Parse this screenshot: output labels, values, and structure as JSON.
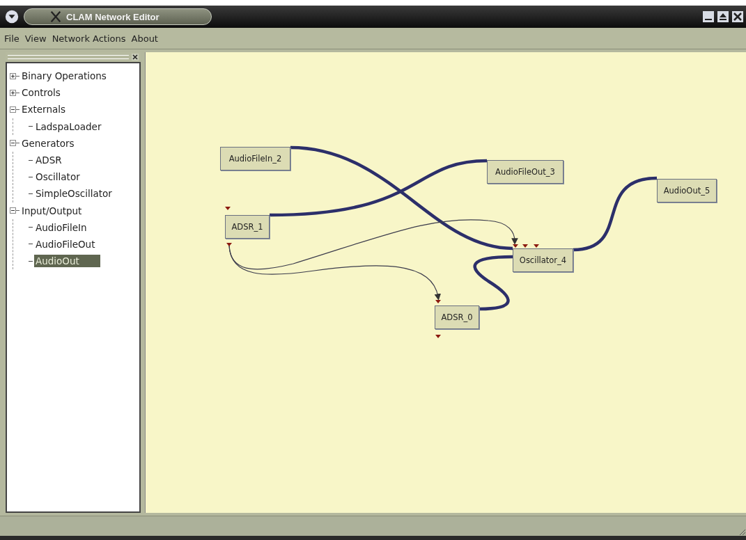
{
  "window": {
    "title": "CLAM Network Editor"
  },
  "menu": [
    {
      "label": "File"
    },
    {
      "label": "View"
    },
    {
      "label": "Network Actions"
    },
    {
      "label": "About"
    }
  ],
  "tree": [
    {
      "label": "Binary Operations",
      "expanded": false,
      "selected": false
    },
    {
      "label": "Controls",
      "expanded": false,
      "selected": false
    },
    {
      "label": "Externals",
      "expanded": true,
      "selected": false,
      "children": [
        {
          "label": "LadspaLoader",
          "selected": false
        }
      ]
    },
    {
      "label": "Generators",
      "expanded": true,
      "selected": false,
      "children": [
        {
          "label": "ADSR",
          "selected": false
        },
        {
          "label": "Oscillator",
          "selected": false
        },
        {
          "label": "SimpleOscillator",
          "selected": false
        }
      ]
    },
    {
      "label": "Input/Output",
      "expanded": true,
      "selected": false,
      "children": [
        {
          "label": "AudioFileIn",
          "selected": false
        },
        {
          "label": "AudioFileOut",
          "selected": false
        },
        {
          "label": "AudioOut",
          "selected": true
        }
      ]
    }
  ],
  "nodes": [
    {
      "label": "AudioFileIn_2"
    },
    {
      "label": "AudioFileOut_3"
    },
    {
      "label": "ADSR_1"
    },
    {
      "label": "Oscillator_4"
    },
    {
      "label": "AudioOut_5"
    },
    {
      "label": "ADSR_0"
    }
  ]
}
